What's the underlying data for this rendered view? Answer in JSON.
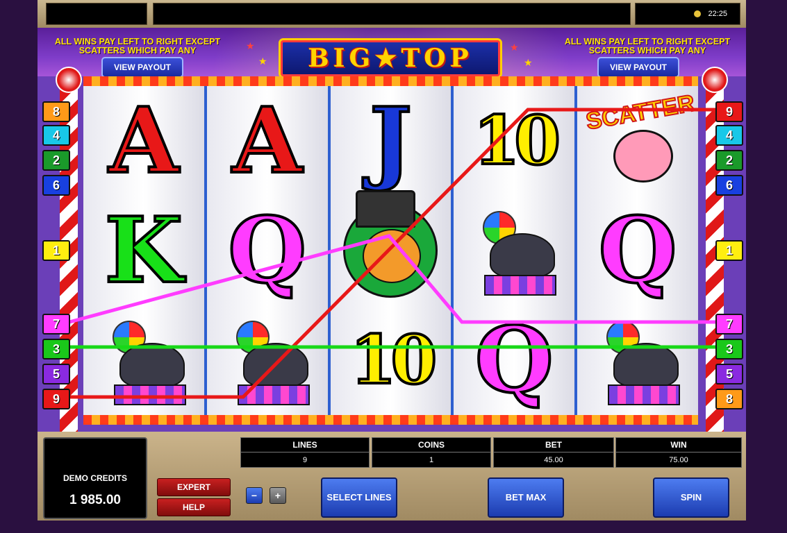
{
  "topbar": {
    "clock": "22:25"
  },
  "header": {
    "rule_left": "ALL WINS PAY LEFT TO RIGHT EXCEPT SCATTERS WHICH PAY ANY",
    "rule_right": "ALL WINS PAY LEFT TO RIGHT EXCEPT SCATTERS WHICH PAY ANY",
    "view_payout_left": "VIEW PAYOUT",
    "view_payout_right": "VIEW PAYOUT",
    "logo": "BIG★TOP"
  },
  "reels": [
    [
      "A",
      "K",
      "seal"
    ],
    [
      "A",
      "Q",
      "seal"
    ],
    [
      "J",
      "tiger",
      "10"
    ],
    [
      "10",
      "seal",
      "Q"
    ],
    [
      "scatter",
      "Q",
      "seal"
    ]
  ],
  "symbol_texts": {
    "scatter": "SCATTER"
  },
  "symbol_colors": {
    "A": "#e81818",
    "K": "#18e018",
    "Q": "#ff3cff",
    "J": "#1838d8",
    "10": "#ffee00"
  },
  "line_badges_left": [
    "8",
    "4",
    "2",
    "6",
    "1",
    "7",
    "3",
    "5",
    "9"
  ],
  "line_badges_right": [
    "9",
    "4",
    "2",
    "6",
    "1",
    "7",
    "3",
    "5",
    "8"
  ],
  "badge_colors": {
    "1": "#ffee10",
    "2": "#1a9a2a",
    "3": "#1ac81a",
    "4": "#18c8e8",
    "5": "#8a2ae0",
    "6": "#1840e0",
    "7": "#ff3cff",
    "8": "#ff9a18",
    "9": "#e81818"
  },
  "panel": {
    "credits_label": "DEMO CREDITS",
    "credits_value": "1 985.00",
    "lines_label": "LINES",
    "lines_value": "9",
    "coins_label": "COINS",
    "coins_value": "1",
    "bet_label": "BET",
    "bet_value": "45.00",
    "win_label": "WIN",
    "win_value": "75.00",
    "expert": "EXPERT",
    "help": "HELP",
    "minus": "−",
    "plus": "+",
    "select_lines": "SELECT LINES",
    "bet_max": "BET MAX",
    "spin": "SPIN"
  },
  "colors": {
    "line_red": "#e81818",
    "line_green": "#18d818",
    "line_magenta": "#ff3cff"
  }
}
